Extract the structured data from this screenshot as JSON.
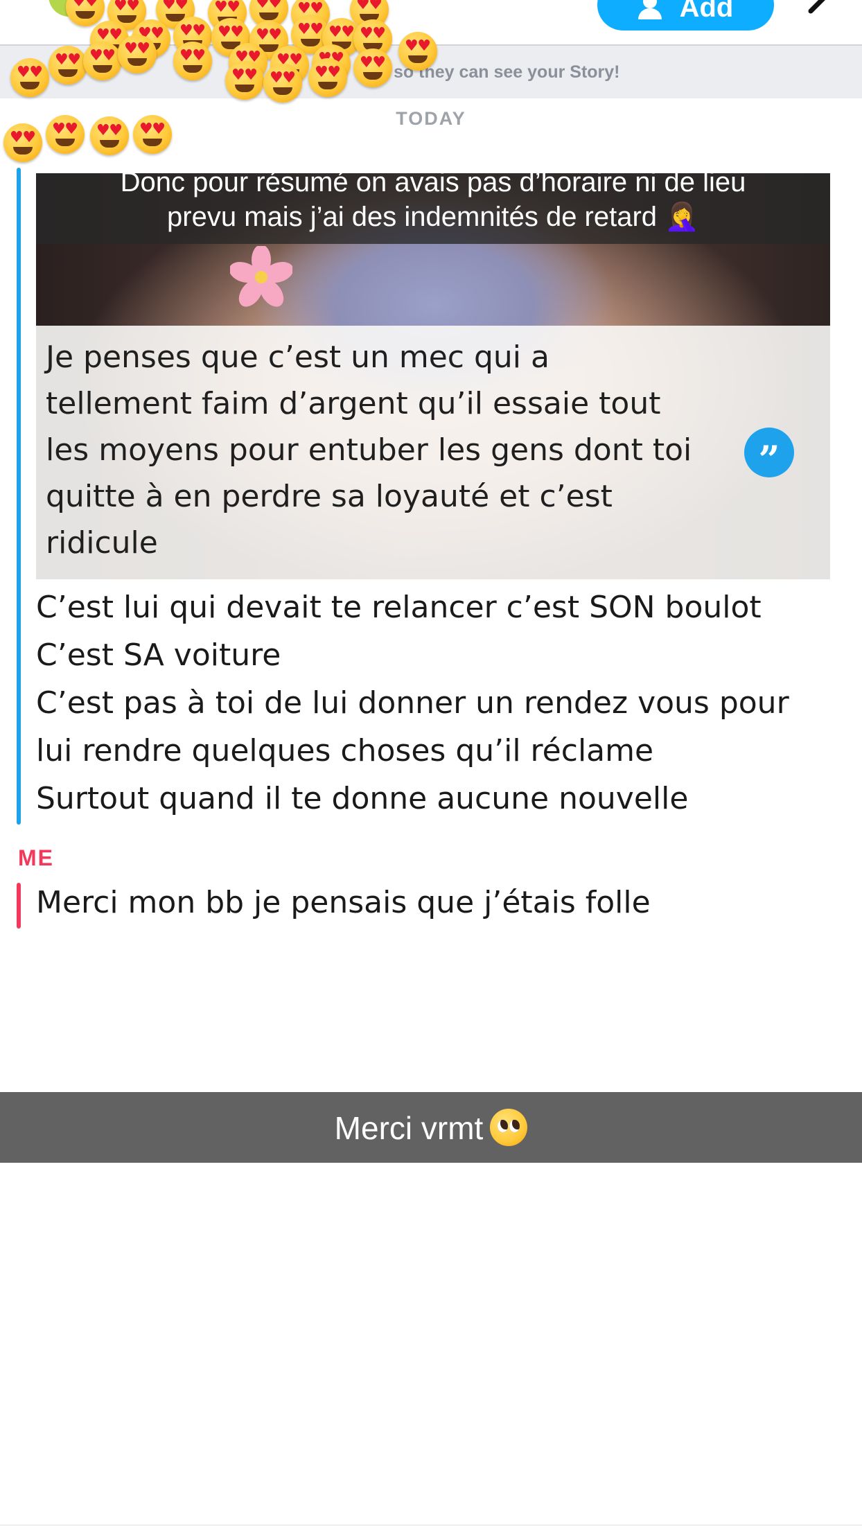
{
  "header": {
    "add_button_label": "Add",
    "icons": [
      "person-add-icon",
      "more-icon"
    ]
  },
  "banner": {
    "visible_text": "so they can see your Story!"
  },
  "day_divider": "TODAY",
  "friend_message": {
    "snap_caption": "Donc pour résumé on avais pas d’horaire ni de lieu\nprevu mais j’ai des indemnités de retard 🤦‍♀️",
    "quoted_text": "Je penses que c’est un mec qui a\ntellement faim d’argent qu’il essaie tout\nles moyens pour entuber les gens dont toi\nquitte à en perdre sa loyauté et c’est\nridicule",
    "lines": [
      "C’est lui qui devait te relancer c’est SON boulot",
      "C’est SA voiture",
      "C’est pas à toi de lui donner un rendez vous pour",
      "lui rendre quelques choses qu’il réclame",
      "Surtout quand il te donne aucune nouvelle"
    ]
  },
  "me": {
    "label": "ME",
    "message": "Merci mon bb je pensais que j’étais folle"
  },
  "caption_overlay": {
    "text": "Merci vrmt",
    "emoji_icon": "pleading-face-icon"
  },
  "colors": {
    "friend_accent": "#1ea2ec",
    "me_accent": "#f2385b",
    "add_button": "#0eadff",
    "banner_bg": "#ecedf0"
  }
}
